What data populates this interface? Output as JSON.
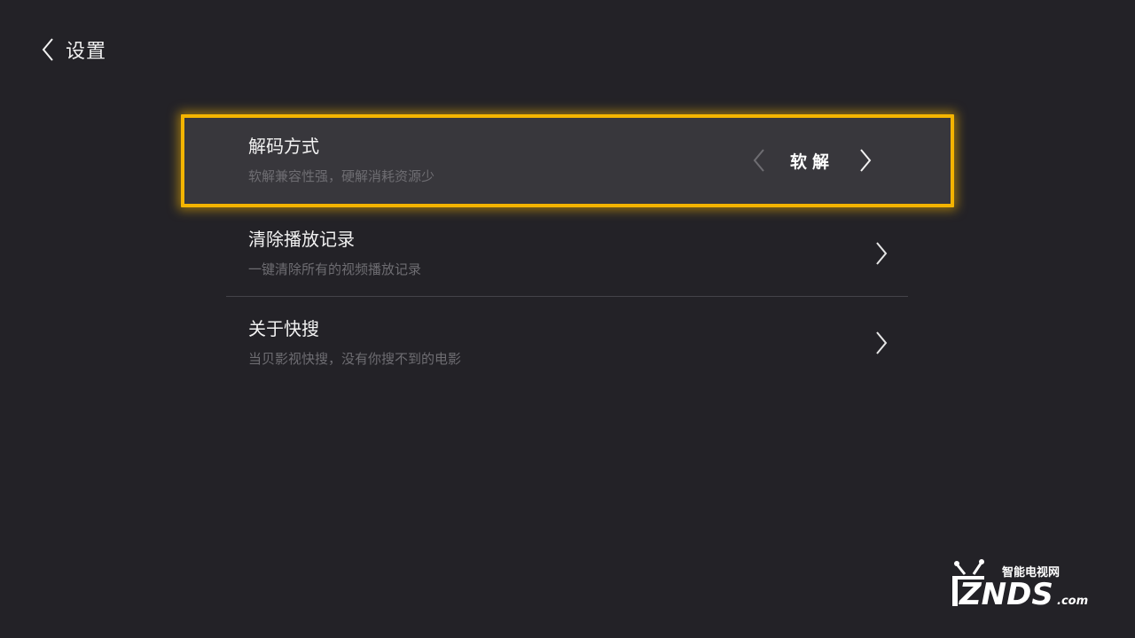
{
  "header": {
    "title": "设置"
  },
  "settings": [
    {
      "title": "解码方式",
      "description": "软解兼容性强，硬解消耗资源少",
      "value": "软解"
    },
    {
      "title": "清除播放记录",
      "description": "一键清除所有的视频播放记录"
    },
    {
      "title": "关于快搜",
      "description": "当贝影视快搜，没有你搜不到的电影"
    }
  ],
  "watermark": {
    "tagline": "智能电视网",
    "brand": "ZNDS",
    "suffix": ".com"
  },
  "colors": {
    "background": "#232227",
    "focus_border": "#f4b400",
    "focused_row": "#38373c"
  },
  "icons": {
    "back": "chevron-left-icon",
    "next": "chevron-right-icon",
    "prev": "chevron-left-icon"
  }
}
